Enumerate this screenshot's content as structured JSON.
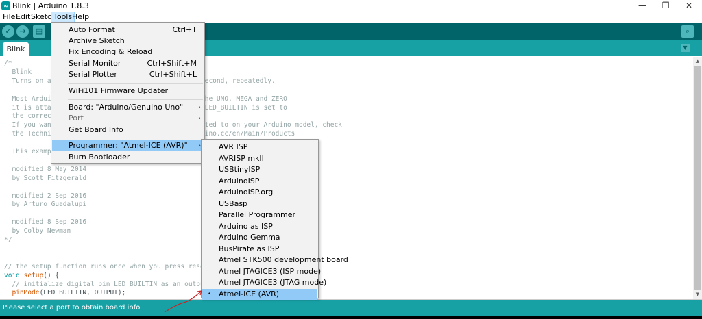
{
  "window": {
    "title": "Blink | Arduino 1.8.3",
    "logo": "∞",
    "controls": [
      "—",
      "❐",
      "✕"
    ]
  },
  "menubar": {
    "items": [
      "File",
      "Edit",
      "Sketch",
      "Tools",
      "Help"
    ],
    "active": "Tools"
  },
  "toolbar": {
    "verify_icon": "✓",
    "upload_icon": "→",
    "new_icon": "▤",
    "open_icon": "↑",
    "save_icon": "↓",
    "serial_monitor_icon": "⌕"
  },
  "tabs": {
    "items": [
      "Blink"
    ],
    "menu_icon": "▼"
  },
  "editor": {
    "lines": [
      {
        "text": "/*",
        "type": "comment"
      },
      {
        "text": "  Blink",
        "type": "comment"
      },
      {
        "text": "  Turns on an",
        "tail": "second, repeatedly.",
        "type": "comment"
      },
      {
        "text": "",
        "type": "comment"
      },
      {
        "text": "  Most Arduin",
        "tail": "the UNO, MEGA and ZERO",
        "type": "comment"
      },
      {
        "text": "  it is attac",
        "tail": " LED_BUILTIN is set to",
        "type": "comment"
      },
      {
        "text": "  the correct",
        "tail": ".",
        "type": "comment"
      },
      {
        "text": "  If you want",
        "tail": "cted to on your Arduino model, check",
        "type": "comment"
      },
      {
        "text": "  the Technic",
        "tail": "uino.cc/en/Main/Products",
        "type": "comment"
      },
      {
        "text": "",
        "type": "comment"
      },
      {
        "text": "  This exampl",
        "type": "comment"
      },
      {
        "text": "",
        "type": "comment"
      },
      {
        "text": "  modified 8 May 2014",
        "type": "comment"
      },
      {
        "text": "  by Scott Fitzgerald",
        "type": "comment"
      },
      {
        "text": "",
        "type": "comment"
      },
      {
        "text": "  modified 2 Sep 2016",
        "type": "comment"
      },
      {
        "text": "  by Arturo Guadalupi",
        "type": "comment"
      },
      {
        "text": "",
        "type": "comment"
      },
      {
        "text": "  modified 8 Sep 2016",
        "type": "comment"
      },
      {
        "text": "  by Colby Newman",
        "type": "comment"
      },
      {
        "text": "*/",
        "type": "comment"
      },
      {
        "text": "",
        "type": "comment"
      },
      {
        "text": "",
        "type": "comment"
      },
      {
        "text": "// the setup function runs once when you press reset or",
        "type": "comment"
      },
      {
        "text_kw": "void",
        "text_fn": "setup",
        "text_rest": "() {",
        "type": "code"
      },
      {
        "text": "  // initialize digital pin LED_BUILTIN as an output.",
        "type": "comment"
      },
      {
        "text_pre": "  ",
        "text_fn": "pinMode",
        "text_rest": "(LED_BUILTIN, OUTPUT);",
        "type": "code2"
      }
    ]
  },
  "tools_menu": {
    "items": [
      {
        "label": "Auto Format",
        "shortcut": "Ctrl+T"
      },
      {
        "label": "Archive Sketch",
        "shortcut": ""
      },
      {
        "label": "Fix Encoding & Reload",
        "shortcut": ""
      },
      {
        "label": "Serial Monitor",
        "shortcut": "Ctrl+Shift+M"
      },
      {
        "label": "Serial Plotter",
        "shortcut": "Ctrl+Shift+L"
      },
      {
        "label": "WiFi101 Firmware Updater",
        "shortcut": ""
      },
      {
        "label": "Board: \"Arduino/Genuino Uno\"",
        "shortcut": ""
      },
      {
        "label": "Port",
        "shortcut": ""
      },
      {
        "label": "Get Board Info",
        "shortcut": ""
      },
      {
        "label": "Programmer: \"Atmel-ICE (AVR)\"",
        "shortcut": ""
      },
      {
        "label": "Burn Bootloader",
        "shortcut": ""
      }
    ],
    "submenu_arrow": "›"
  },
  "programmer_menu": {
    "items": [
      "AVR ISP",
      "AVRISP mkII",
      "USBtinyISP",
      "ArduinoISP",
      "ArduinoISP.org",
      "USBasp",
      "Parallel Programmer",
      "Arduino as ISP",
      "Arduino Gemma",
      "BusPirate as ISP",
      "Atmel STK500 development board",
      "Atmel JTAGICE3 (ISP mode)",
      "Atmel JTAGICE3 (JTAG mode)",
      "Atmel-ICE (AVR)"
    ],
    "selected": "Atmel-ICE (AVR)",
    "selected_mark": "•"
  },
  "status": {
    "message": "Please select a port to obtain board info"
  },
  "scrollbar": {
    "up_icon": "▲",
    "down_icon": "▼"
  },
  "colors": {
    "toolbar": "#006468",
    "tabbar": "#17a1a5",
    "menu_highlight": "#91c9f7",
    "annotation": "#cc2222"
  }
}
